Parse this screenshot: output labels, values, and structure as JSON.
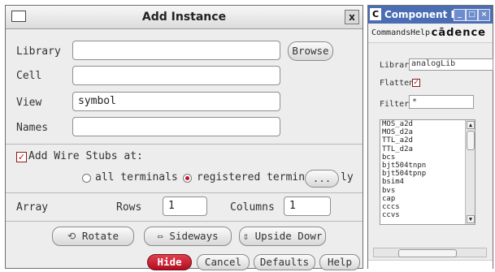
{
  "add_instance": {
    "title": "Add Instance",
    "close_glyph": "x",
    "library": {
      "label": "Library",
      "value": ""
    },
    "browse_label": "Browse",
    "cell": {
      "label": "Cell",
      "value": ""
    },
    "view": {
      "label": "View",
      "value": "symbol"
    },
    "names": {
      "label": "Names",
      "value": ""
    },
    "wire_stubs": {
      "label": "Add Wire Stubs at:",
      "checked": true,
      "option_all": "all terminals",
      "option_registered": "registered termina",
      "selected": "registered",
      "more_label": "...",
      "trailing_text": "ly"
    },
    "array": {
      "label": "Array",
      "rows_label": "Rows",
      "rows_value": "1",
      "columns_label": "Columns",
      "columns_value": "1"
    },
    "transform": {
      "rotate_label": "Rotate",
      "sideways_label": "Sideways",
      "upside_down_label": "Upside Dowr"
    },
    "footer": {
      "hide_label": "Hide",
      "cancel_label": "Cancel",
      "defaults_label": "Defaults",
      "help_label": "Help"
    }
  },
  "component_browser": {
    "title": "Component Brows",
    "icon_letter": "C",
    "menu": {
      "commands": "Commands",
      "help": "Help"
    },
    "logo": "cādence",
    "library": {
      "label": "Library",
      "value": "analogLib"
    },
    "flatten": {
      "label": "Flatten",
      "checked": true
    },
    "filter": {
      "label": "Filter",
      "value": "*"
    },
    "cells": [
      "MOS_a2d",
      "MOS_d2a",
      "TTL_a2d",
      "TTL_d2a",
      "bcs",
      "bjt504tnpn",
      "bjt504tpnp",
      "bsim4",
      "bvs",
      "cap",
      "cccs",
      "ccvs"
    ]
  },
  "colors": {
    "accent_red": "#c0102a",
    "titlebar_blue": "#4a6db4",
    "dialog_bg": "#ededed"
  }
}
